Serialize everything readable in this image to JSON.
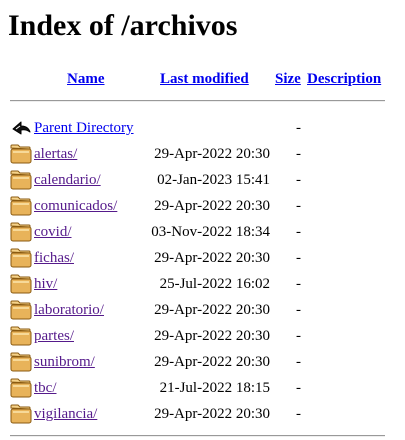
{
  "title": "Index of /archivos",
  "columns": {
    "name": "Name",
    "last_modified": "Last modified",
    "size": "Size",
    "description": "Description"
  },
  "entries": [
    {
      "icon": "back-arrow-icon",
      "name": "Parent Directory",
      "modified": "",
      "size": "-",
      "visited": false
    },
    {
      "icon": "folder-icon",
      "name": "alertas/",
      "modified": "29-Apr-2022 20:30",
      "size": "-",
      "visited": true
    },
    {
      "icon": "folder-icon",
      "name": "calendario/",
      "modified": "02-Jan-2023 15:41",
      "size": "-",
      "visited": true
    },
    {
      "icon": "folder-icon",
      "name": "comunicados/",
      "modified": "29-Apr-2022 20:30",
      "size": "-",
      "visited": true
    },
    {
      "icon": "folder-icon",
      "name": "covid/",
      "modified": "03-Nov-2022 18:34",
      "size": "-",
      "visited": true
    },
    {
      "icon": "folder-icon",
      "name": "fichas/",
      "modified": "29-Apr-2022 20:30",
      "size": "-",
      "visited": true
    },
    {
      "icon": "folder-icon",
      "name": "hiv/",
      "modified": "25-Jul-2022 16:02",
      "size": "-",
      "visited": true
    },
    {
      "icon": "folder-icon",
      "name": "laboratorio/",
      "modified": "29-Apr-2022 20:30",
      "size": "-",
      "visited": true
    },
    {
      "icon": "folder-icon",
      "name": "partes/",
      "modified": "29-Apr-2022 20:30",
      "size": "-",
      "visited": true
    },
    {
      "icon": "folder-icon",
      "name": "sunibrom/",
      "modified": "29-Apr-2022 20:30",
      "size": "-",
      "visited": true
    },
    {
      "icon": "folder-icon",
      "name": "tbc/",
      "modified": "21-Jul-2022 18:15",
      "size": "-",
      "visited": true
    },
    {
      "icon": "folder-icon",
      "name": "vigilancia/",
      "modified": "29-Apr-2022 20:30",
      "size": "-",
      "visited": true
    }
  ],
  "colors": {
    "link": "#0000ee",
    "visited_link": "#551a8b",
    "folder": "#e8b35a",
    "rule": "#999999"
  }
}
